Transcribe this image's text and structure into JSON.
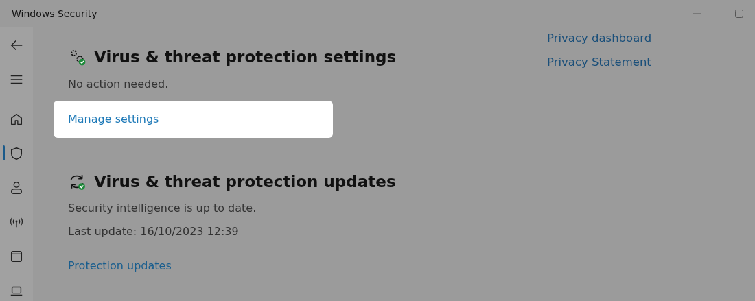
{
  "window": {
    "title": "Windows Security"
  },
  "sidebar": {
    "items": [
      {
        "selected": false
      },
      {
        "selected": true
      },
      {
        "selected": false
      },
      {
        "selected": false
      },
      {
        "selected": false
      },
      {
        "selected": false
      }
    ]
  },
  "sections": [
    {
      "title": "Virus & threat protection settings",
      "lines": [
        "No action needed."
      ],
      "link": {
        "label": "Manage settings",
        "highlighted": true
      }
    },
    {
      "title": "Virus & threat protection updates",
      "lines": [
        "Security intelligence is up to date.",
        "Last update: 16/10/2023 12:39"
      ],
      "link": {
        "label": "Protection updates",
        "highlighted": false
      }
    }
  ],
  "side_links": [
    "Privacy dashboard",
    "Privacy Statement"
  ]
}
